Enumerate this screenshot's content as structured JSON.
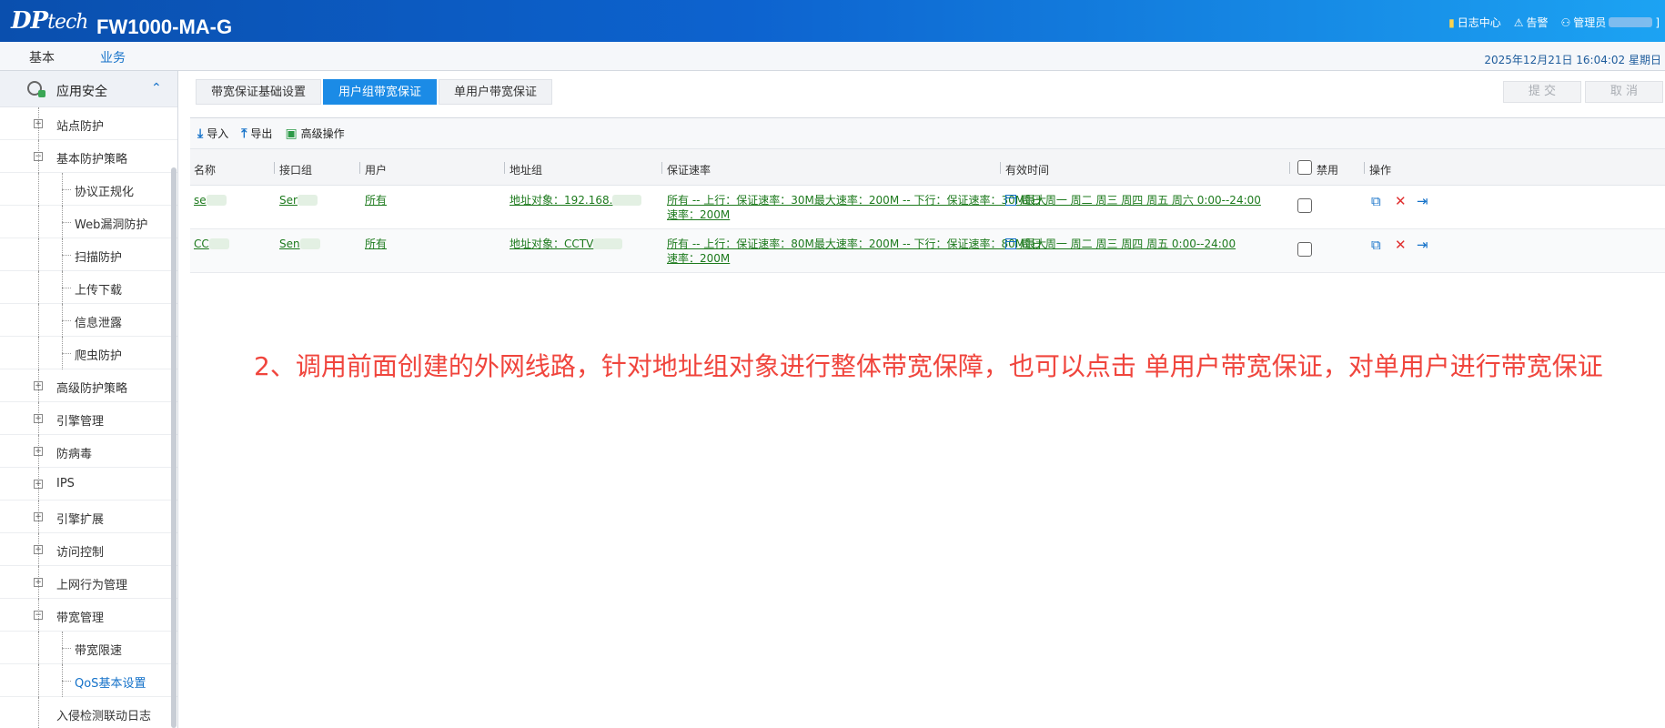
{
  "header": {
    "logo_main": "DP",
    "logo_sub": "tech",
    "product": "FW1000-MA-G",
    "log_center": "日志中心",
    "alarm": "告警",
    "admin": "管理员"
  },
  "nav": {
    "tabs": [
      "基本",
      "业务"
    ],
    "active": "业务",
    "datetime": "2025年12月21日   16:04:02   星期日"
  },
  "sidebar": {
    "section": "应用安全",
    "items": [
      {
        "label": "站点防护",
        "level": 1,
        "toggle": "+"
      },
      {
        "label": "基本防护策略",
        "level": 1,
        "toggle": "−"
      },
      {
        "label": "协议正规化",
        "level": 2
      },
      {
        "label": "Web漏洞防护",
        "level": 2
      },
      {
        "label": "扫描防护",
        "level": 2
      },
      {
        "label": "上传下载",
        "level": 2
      },
      {
        "label": "信息泄露",
        "level": 2
      },
      {
        "label": "爬虫防护",
        "level": 2
      },
      {
        "label": "高级防护策略",
        "level": 1,
        "toggle": "+"
      },
      {
        "label": "引擎管理",
        "level": 1,
        "toggle": "+"
      },
      {
        "label": "防病毒",
        "level": 1,
        "toggle": "+"
      },
      {
        "label": "IPS",
        "level": 1,
        "toggle": "+"
      },
      {
        "label": "引擎扩展",
        "level": 1,
        "toggle": "+"
      },
      {
        "label": "访问控制",
        "level": 1,
        "toggle": "+"
      },
      {
        "label": "上网行为管理",
        "level": 1,
        "toggle": "+"
      },
      {
        "label": "带宽管理",
        "level": 1,
        "toggle": "−"
      },
      {
        "label": "带宽限速",
        "level": 2
      },
      {
        "label": "QoS基本设置",
        "level": 2,
        "selected": true
      },
      {
        "label": "入侵检测联动日志",
        "level": 1
      }
    ]
  },
  "subtabs": [
    "带宽保证基础设置",
    "用户组带宽保证",
    "单用户带宽保证"
  ],
  "active_subtab": "用户组带宽保证",
  "actions": {
    "submit": "提 交",
    "cancel": "取 消"
  },
  "toolbar": {
    "import": "导入",
    "export": "导出",
    "advanced": "高级操作"
  },
  "table": {
    "headers": {
      "name": "名称",
      "iface_group": "接口组",
      "user": "用户",
      "addr_group": "地址组",
      "rate": "保证速率",
      "time": "有效时间",
      "disable": "禁用",
      "ops": "操作"
    },
    "rows": [
      {
        "name": "se",
        "iface_group": "Ser",
        "user": "所有",
        "addr_group": "地址对象：192.168.",
        "rate": "所有 -- 上行：保证速率：30M最大速率：200M -- 下行：保证速率：30M最大速率：200M",
        "time": "周日 周一 周二 周三 周四 周五 周六 0:00--24:00"
      },
      {
        "name": "CC",
        "iface_group": "Sen",
        "user": "所有",
        "addr_group": "地址对象：CCTV",
        "rate": "所有 -- 上行：保证速率：80M最大速率：200M -- 下行：保证速率：80M最大速率：200M",
        "time": "周日 周一 周二 周三 周四 周五 0:00--24:00"
      }
    ]
  },
  "annotation": "2、调用前面创建的外网线路，针对地址组对象进行整体带宽保障，也可以点击 单用户带宽保证，对单用户进行带宽保证",
  "icons": {
    "log": "bar-chart-icon",
    "alarm": "warning-icon",
    "admin": "user-icon",
    "import": "download-icon",
    "export": "upload-icon",
    "advanced": "advanced-icon",
    "copy": "copy-icon",
    "delete": "close-icon",
    "move": "move-icon"
  },
  "colors": {
    "header_start": "#0a4fae",
    "header_end": "#1ca3f3",
    "accent": "#1b8be6",
    "link": "#1d7a1d",
    "annotation": "#f0453d"
  }
}
